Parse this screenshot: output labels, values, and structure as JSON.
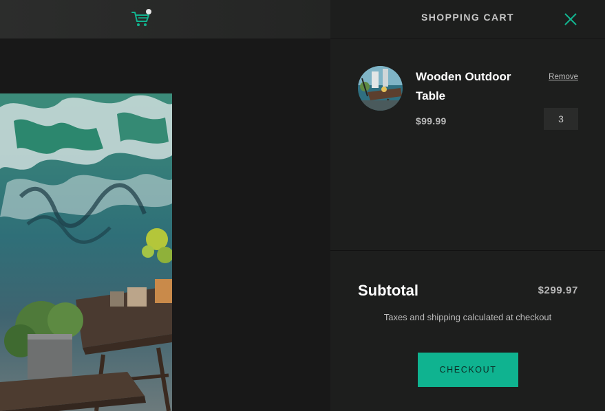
{
  "header": {
    "cart_icon": "shopping-cart-icon",
    "cart_badge_color": "#e6e6e6",
    "accent_color": "#12b38f"
  },
  "background_image": "outdoor-cafe-table-photo",
  "drawer": {
    "title": "SHOPPING CART",
    "close_icon": "close-icon",
    "items": [
      {
        "name": "Wooden Outdoor Table",
        "price": "$99.99",
        "quantity": "3",
        "remove_label": "Remove",
        "thumbnail": "wooden-outdoor-table-thumbnail"
      }
    ],
    "subtotal_label": "Subtotal",
    "subtotal_value": "$299.97",
    "tax_note": "Taxes and shipping calculated at checkout",
    "checkout_label": "CHECKOUT",
    "checkout_color": "#0fb390"
  }
}
